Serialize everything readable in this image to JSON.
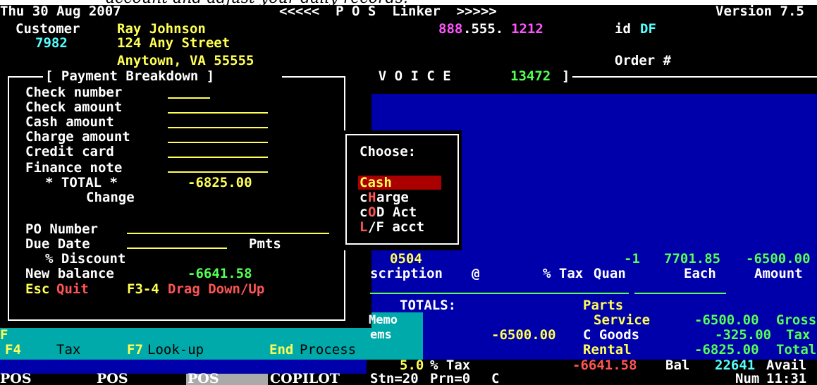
{
  "caption_fragment": "account and adjust your daily records.",
  "header": {
    "date": "Thu 30 Aug 2007",
    "title": "<<<<<  P O S  Linker  >>>>>",
    "version": "Version 7.5"
  },
  "customer": {
    "label": "Customer",
    "name": "Ray Johnson",
    "number": "7982",
    "street": "124 Any Street",
    "city": "Anytown, VA 55555",
    "phone_a": "888",
    "phone_b": ".555.",
    "phone_c": "1212",
    "id_label": "id",
    "id_value": "DF",
    "order_label": "Order #"
  },
  "invoice": {
    "label": "I N V O I C E",
    "number": "13472",
    "close": "]"
  },
  "payment": {
    "title": "[ Payment Breakdown ]",
    "fields": [
      {
        "label": "Check number",
        "value": ""
      },
      {
        "label": "Check amount",
        "value": ""
      },
      {
        "label": "Cash amount",
        "value": ""
      },
      {
        "label": "Charge amount",
        "value": ""
      },
      {
        "label": "Credit card",
        "value": ""
      },
      {
        "label": "Finance note",
        "value": ""
      }
    ],
    "total_label": "* TOTAL *",
    "total_value": "-6825.00",
    "change_label": "Change",
    "po_label": "PO Number",
    "due_label": "Due Date",
    "pmts_label": "Pmts",
    "discount_label": "% Discount",
    "new_balance_label": "New balance",
    "new_balance_value": "-6641.58",
    "esc_key": "Esc",
    "esc_action": "Quit",
    "f34_key": "F3-4",
    "f34_action": "Drag Down/Up"
  },
  "choose": {
    "title": "Choose:",
    "options": [
      {
        "pre": "",
        "hot": "",
        "post": "Cash",
        "selected": true
      },
      {
        "pre": "c",
        "hot": "H",
        "post": "arge",
        "selected": false
      },
      {
        "pre": "c",
        "hot": "O",
        "post": "D Act",
        "selected": false
      },
      {
        "pre": "",
        "hot": "L",
        "post": "/F acct",
        "selected": false
      }
    ]
  },
  "line_item": {
    "code": "0504",
    "qty": "-1",
    "each": "7701.85",
    "amount": "-6500.00"
  },
  "columns": {
    "description": "scription",
    "at": "@",
    "tax": "% Tax",
    "quan": "Quan",
    "each": "Each",
    "amount": "Amount"
  },
  "totals": {
    "label": "TOTALS:",
    "memo": "Memo",
    "items": "ems",
    "items_value": "-6500.00",
    "parts": "Parts",
    "service": "Service",
    "gross_value": "-6500.00",
    "gross_label": "Gross",
    "cgoods": "C Goods",
    "tax_value": "-325.00",
    "tax_label": "Tax",
    "rental": "Rental",
    "total_value": "-6825.00",
    "total_label": "Total"
  },
  "fkeys": {
    "f_partial": "F",
    "f4": "F4",
    "tax": "Tax",
    "f7": "F7",
    "lookup": "Look-up",
    "end": "End",
    "process": "Process"
  },
  "summary": {
    "tax_rate": "5.0",
    "tax_suffix": "% Tax",
    "bal_value": "-6641.58",
    "bal_label": "Bal",
    "avail_value": "22641",
    "avail_label": "Avail"
  },
  "status": {
    "tab1": "POS",
    "tab2": "POS",
    "tab3": "POS",
    "tab4": "COPILOT",
    "stn": "Stn=20",
    "prn": "Prn=0",
    "c": "C",
    "num": "Num",
    "time": "11:31"
  },
  "colors": {
    "background": "#000000",
    "blue_panel": "#0000aa",
    "teal": "#00aaaa",
    "yellow": "#ffff55",
    "white": "#ffffff",
    "cyan": "#55ffff",
    "green": "#55ff55",
    "red": "#ff5555",
    "magenta": "#ff55ff",
    "selection": "#aa0000"
  }
}
